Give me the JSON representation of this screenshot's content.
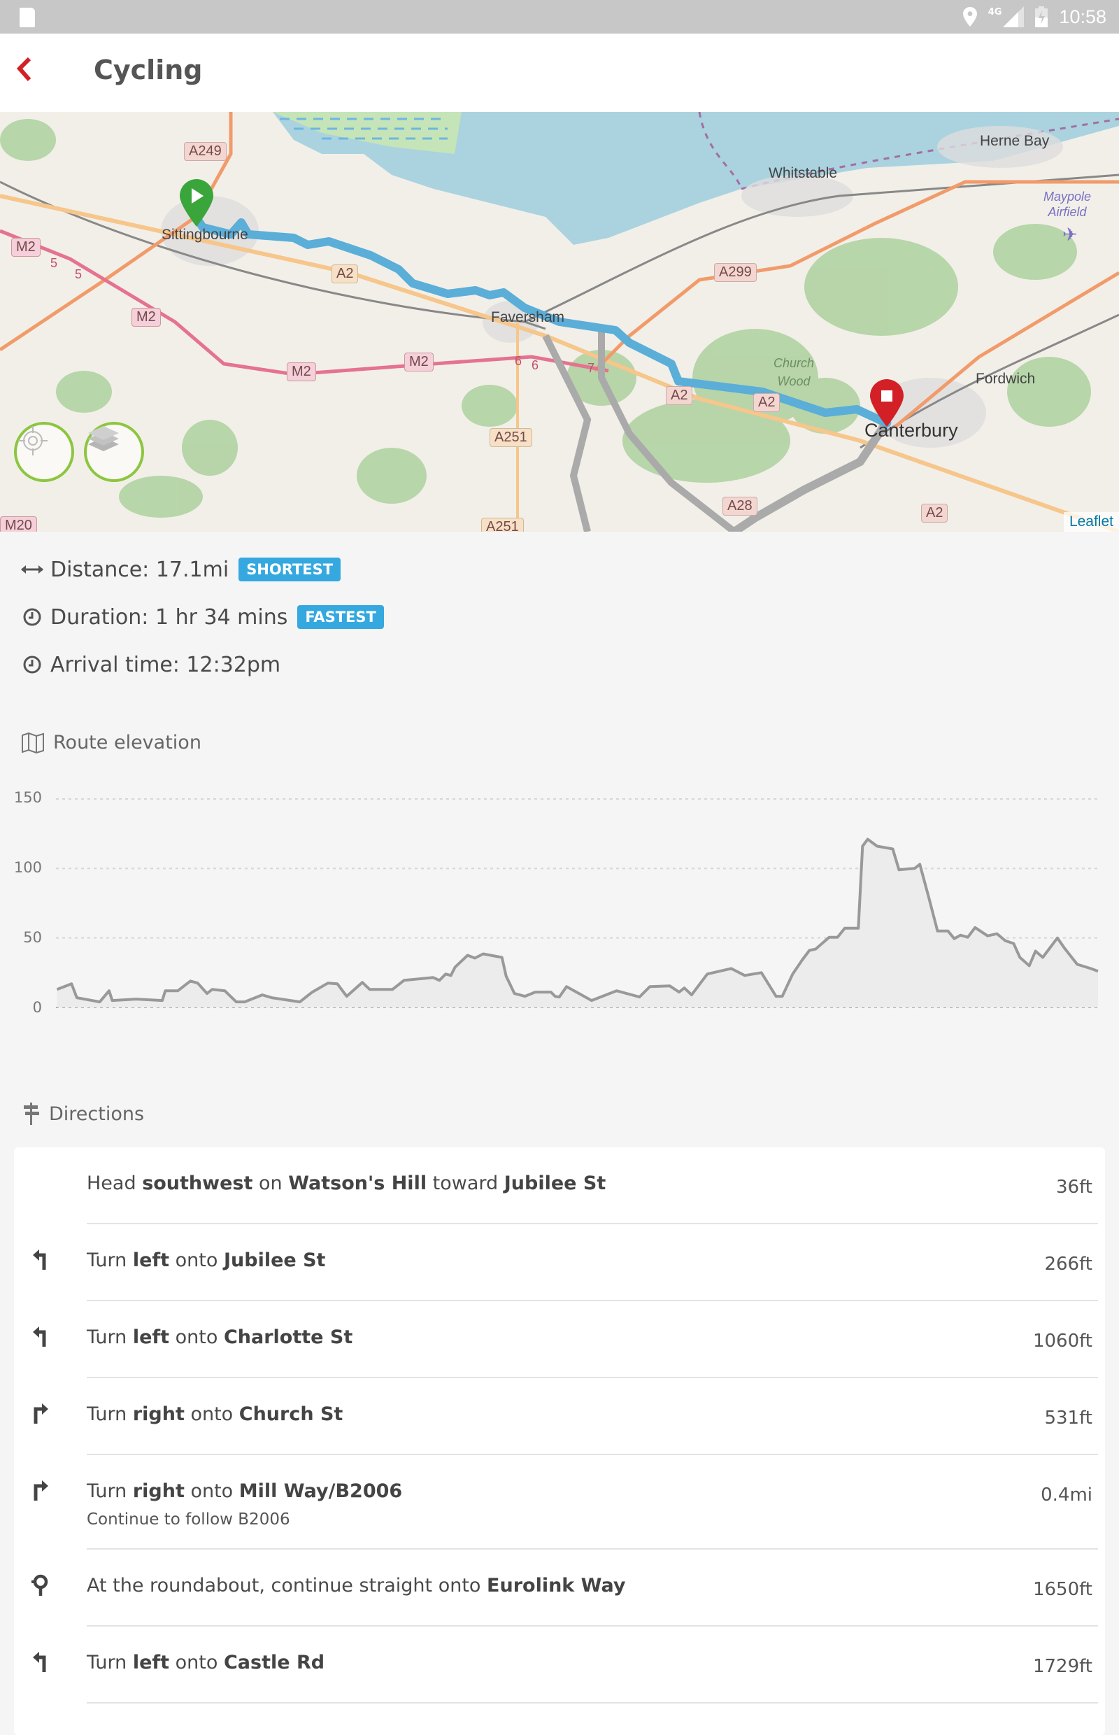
{
  "status_bar": {
    "time": "10:58",
    "network": "4G",
    "icons": [
      "sd-card-icon",
      "location-icon",
      "signal-icon",
      "battery-charging-icon"
    ]
  },
  "header": {
    "title": "Cycling",
    "back_icon": "chevron-left-icon",
    "accent": "#d32027"
  },
  "map": {
    "place_labels": [
      "Sittingbourne",
      "Faversham",
      "Whitstable",
      "Herne Bay",
      "Maypole Airfield",
      "Church Wood",
      "Fordwich",
      "Canterbury"
    ],
    "road_labels": [
      "A249",
      "M2",
      "M2",
      "M2",
      "M2",
      "A2",
      "A2",
      "A2",
      "A2",
      "A299",
      "A251",
      "A251",
      "A28",
      "M20"
    ],
    "junction_labels": [
      "5",
      "5",
      "6",
      "6",
      "7"
    ],
    "start_marker": "play-marker-icon",
    "end_marker": "stop-marker-icon",
    "start_color": "#3aa53a",
    "end_color": "#d32027",
    "route_color": "#5aaed8",
    "locate_button": "crosshair-icon",
    "layers_button": "layers-icon",
    "attribution": "Leaflet"
  },
  "summary": {
    "distance_label": "Distance: 17.1mi",
    "distance_badge": "SHORTEST",
    "duration_label": "Duration: 1 hr 34 mins",
    "duration_badge": "FASTEST",
    "arrival_label": "Arrival time: 12:32pm",
    "badge_color": "#35a8df"
  },
  "elevation": {
    "heading": "Route elevation"
  },
  "chart_data": {
    "type": "area",
    "title": "Route elevation",
    "xlabel": "",
    "ylabel": "",
    "x_unit": "percent of route",
    "yticks": [
      0,
      50,
      100,
      150
    ],
    "ylim": [
      0,
      150
    ],
    "xlim": [
      0,
      100
    ],
    "grid": true,
    "legend": "none",
    "series": [
      {
        "name": "elevation",
        "x": [
          0.1,
          1.5,
          2.0,
          4.2,
          5.1,
          5.4,
          7.7,
          10.2,
          10.5,
          11.7,
          12.9,
          13.6,
          14.5,
          15.0,
          16.2,
          17.3,
          18.1,
          19.8,
          20.7,
          23.4,
          24.6,
          26.1,
          27.0,
          27.9,
          29.4,
          30.1,
          32.3,
          33.4,
          36.2,
          36.8,
          37.4,
          37.9,
          38.3,
          39.5,
          40.2,
          41.0,
          42.8,
          43.2,
          44.0,
          45.0,
          46.0,
          47.5,
          47.9,
          48.3,
          49.0,
          51.4,
          53.8,
          56.0,
          57.0,
          58.9,
          59.8,
          60.3,
          61.0,
          62.5,
          64.8,
          66.1,
          67.7,
          69.1,
          69.7,
          70.7,
          71.6,
          72.3,
          72.9,
          74.2,
          75.0,
          75.7,
          77.0,
          77.4,
          77.9,
          78.8,
          80.3,
          80.9,
          82.4,
          82.9,
          83.8,
          84.6,
          85.6,
          86.2,
          86.8,
          87.5,
          88.2,
          89.4,
          90.3,
          91.1,
          91.9,
          92.5,
          93.4,
          94.0,
          94.7,
          96.1,
          96.8,
          98.0,
          99.3,
          100
        ],
        "values": [
          13,
          17,
          7,
          4,
          12,
          5,
          6,
          5,
          12,
          12,
          19,
          17.5,
          10,
          13,
          12,
          4,
          4,
          9,
          7,
          4,
          11,
          17.5,
          17,
          8,
          18,
          13,
          13,
          19.5,
          21.5,
          19.5,
          24,
          23,
          29,
          37.5,
          35.5,
          38.5,
          36,
          22.5,
          10,
          8,
          11,
          11,
          8,
          7.5,
          15,
          5,
          12,
          7.5,
          15,
          15.5,
          11,
          14,
          9,
          24,
          28,
          23,
          25,
          8,
          8,
          24,
          34,
          41,
          42,
          50.5,
          50.5,
          57,
          57,
          116,
          121,
          116,
          114,
          99,
          100,
          103,
          78,
          55,
          55,
          49.5,
          52,
          50.5,
          57.5,
          51.5,
          53,
          48,
          46,
          36,
          30,
          40.5,
          36,
          50,
          42.5,
          31,
          28,
          26
        ]
      }
    ],
    "line_color": "#999999",
    "fill_color": "#ececec"
  },
  "directions": {
    "heading": "Directions",
    "steps": [
      {
        "icon": "none",
        "parts": [
          [
            "Head ",
            false
          ],
          [
            "southwest",
            true
          ],
          [
            " on ",
            false
          ],
          [
            "Watson's Hill",
            true
          ],
          [
            " toward ",
            false
          ],
          [
            "Jubilee St",
            true
          ]
        ],
        "sub": "",
        "distance": "36ft"
      },
      {
        "icon": "turn-left-icon",
        "parts": [
          [
            "Turn ",
            false
          ],
          [
            "left",
            true
          ],
          [
            " onto ",
            false
          ],
          [
            "Jubilee St",
            true
          ]
        ],
        "sub": "",
        "distance": "266ft"
      },
      {
        "icon": "turn-left-icon",
        "parts": [
          [
            "Turn ",
            false
          ],
          [
            "left",
            true
          ],
          [
            " onto ",
            false
          ],
          [
            "Charlotte St",
            true
          ]
        ],
        "sub": "",
        "distance": "1060ft"
      },
      {
        "icon": "turn-right-icon",
        "parts": [
          [
            "Turn ",
            false
          ],
          [
            "right",
            true
          ],
          [
            " onto ",
            false
          ],
          [
            "Church St",
            true
          ]
        ],
        "sub": "",
        "distance": "531ft"
      },
      {
        "icon": "turn-right-icon",
        "parts": [
          [
            "Turn ",
            false
          ],
          [
            "right",
            true
          ],
          [
            " onto ",
            false
          ],
          [
            "Mill Way/B2006",
            true
          ]
        ],
        "sub": "Continue to follow B2006",
        "distance": "0.4mi"
      },
      {
        "icon": "roundabout-icon",
        "parts": [
          [
            "At the roundabout, continue straight onto ",
            false
          ],
          [
            "Eurolink Way",
            true
          ]
        ],
        "sub": "",
        "distance": "1650ft"
      },
      {
        "icon": "turn-left-icon",
        "parts": [
          [
            "Turn ",
            false
          ],
          [
            "left",
            true
          ],
          [
            " onto ",
            false
          ],
          [
            "Castle Rd",
            true
          ]
        ],
        "sub": "",
        "distance": "1729ft"
      }
    ]
  }
}
